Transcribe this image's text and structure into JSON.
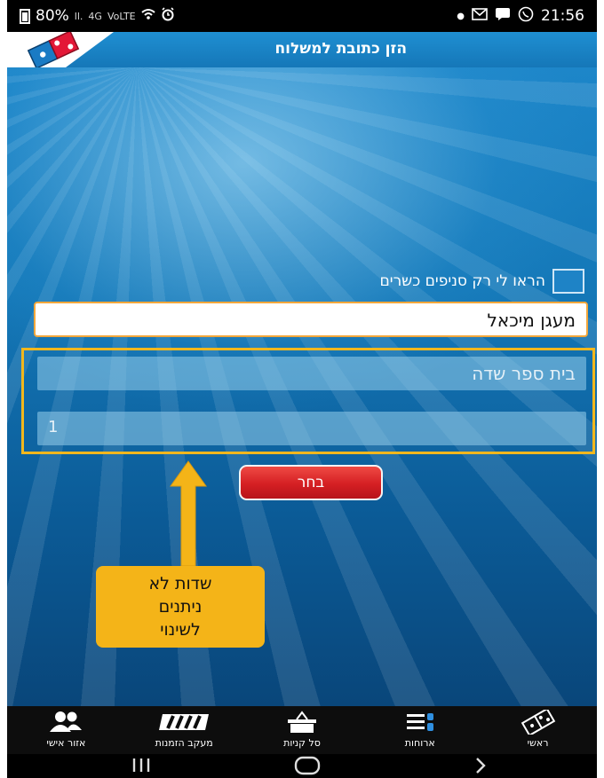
{
  "status_bar": {
    "battery": "80%",
    "signal_small": "ll.",
    "net_4g": "4G",
    "volte": "VoLTE",
    "time": "21:56"
  },
  "header": {
    "title": "הזן כתובת למשלוח"
  },
  "filter": {
    "checkbox_label": "הראו לי רק סניפים כשרים",
    "checked": false
  },
  "form": {
    "city_value": "מעגן מיכאל",
    "street_value": "בית ספר שדה",
    "house_number_value": "1"
  },
  "choose_button": {
    "label": "בחר"
  },
  "annotation": {
    "callout_line1": "שדות לא",
    "callout_line2": "ניתנים",
    "callout_line3": "לשינוי",
    "color": "#f2b71d"
  },
  "bottom_nav": {
    "items": [
      {
        "label": "אזור אישי",
        "icon": "personal-area-icon"
      },
      {
        "label": "מעקב הזמנות",
        "icon": "order-tracking-icon"
      },
      {
        "label": "סל קניות",
        "icon": "shopping-cart-icon"
      },
      {
        "label": "ארוחות",
        "icon": "meals-icon"
      },
      {
        "label": "ראשי",
        "icon": "domino-home-icon"
      }
    ]
  },
  "colors": {
    "brand_blue": "#1577b8",
    "button_red": "#d51f23",
    "accent_orange": "#f3a73b"
  }
}
